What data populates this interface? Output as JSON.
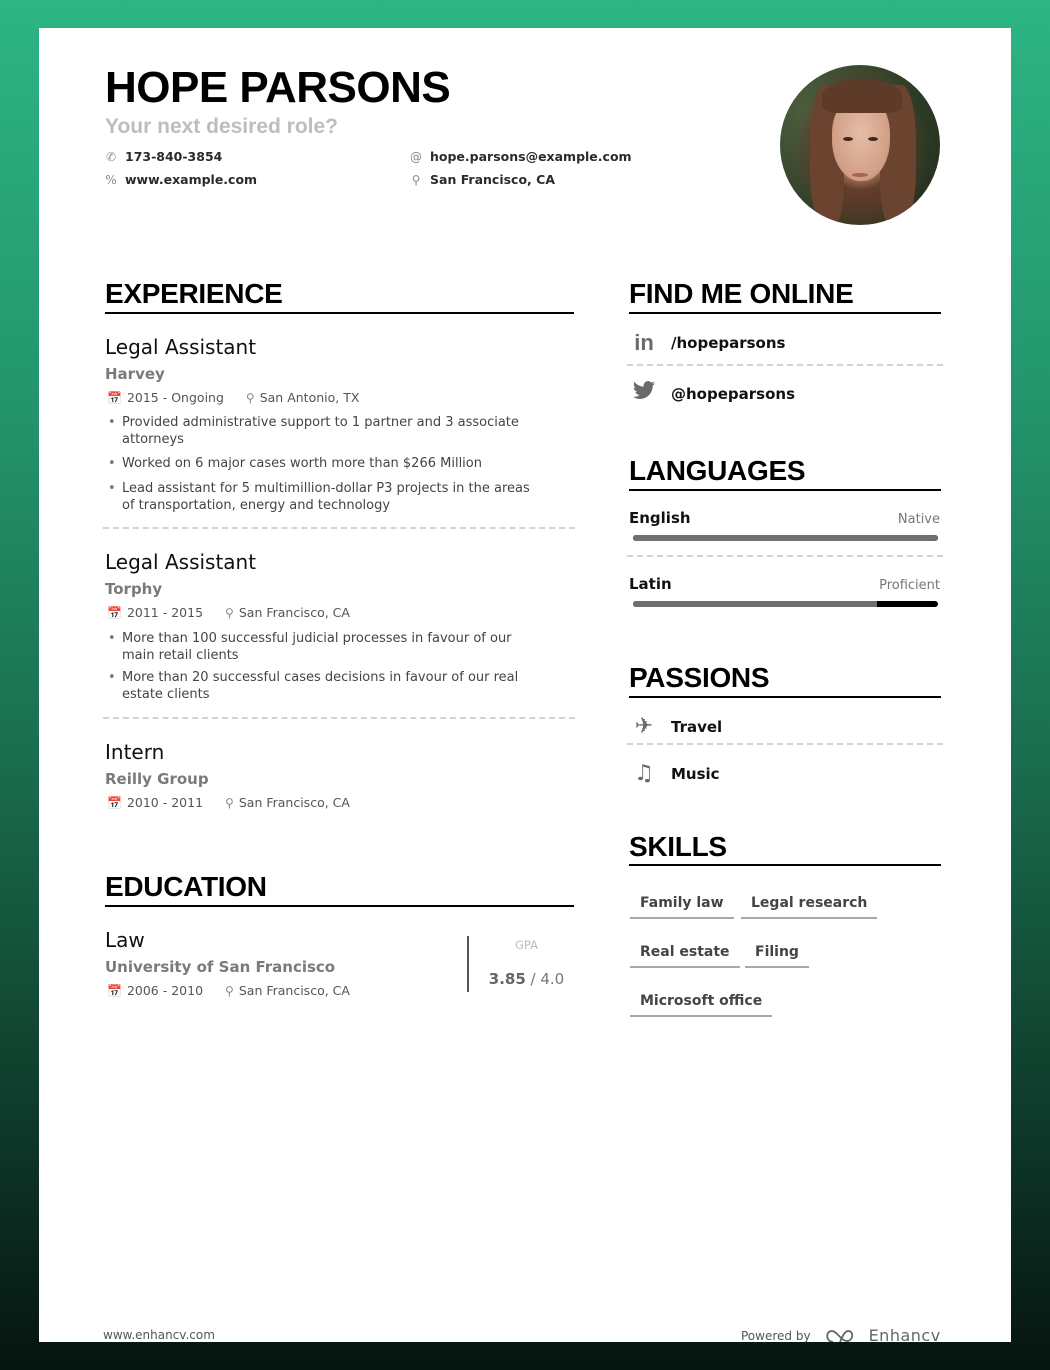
{
  "header": {
    "name": "HOPE PARSONS",
    "role": "Your next desired role?",
    "contacts": {
      "phone": "173-840-3854",
      "website": "www.example.com",
      "email": "hope.parsons@example.com",
      "location": "San Francisco, CA"
    },
    "icons": {
      "phone": "phone-icon",
      "website": "link-icon",
      "email": "at-icon",
      "location": "map-pin-icon"
    },
    "photo_alt": "Hope Parsons profile photo"
  },
  "experience": {
    "title": "EXPERIENCE",
    "items": [
      {
        "title": "Legal Assistant",
        "company": "Harvey",
        "dates": "2015 - Ongoing",
        "location": "San Antonio, TX",
        "bullets": [
          "Provided administrative support to 1 partner and 3 associate attorneys",
          "Worked on 6 major cases worth more than $266 Million",
          "Lead assistant for 5 multimillion-dollar P3 projects in the areas of transportation, energy and technology"
        ]
      },
      {
        "title": "Legal Assistant",
        "company": "Torphy",
        "dates": "2011 - 2015",
        "location": "San Francisco, CA",
        "bullets": [
          "More than 100 successful judicial processes in favour of our main retail clients",
          "More than 20 successful cases decisions in favour of our real estate clients"
        ]
      },
      {
        "title": "Intern",
        "company": "Reilly Group",
        "dates": "2010 - 2011",
        "location": "San Francisco, CA",
        "bullets": []
      }
    ]
  },
  "education": {
    "title": "EDUCATION",
    "items": [
      {
        "degree": "Law",
        "school": "University of San Francisco",
        "dates": "2006 - 2010",
        "location": "San Francisco, CA",
        "gpa_label": "GPA",
        "gpa": "3.85",
        "gpa_sep": " / ",
        "gpa_max": "4.0"
      }
    ]
  },
  "online": {
    "title": "FIND ME ONLINE",
    "items": [
      {
        "network": "LinkedIn",
        "icon": "linkedin-icon",
        "handle": "/hopeparsons"
      },
      {
        "network": "Twitter",
        "icon": "twitter-icon",
        "handle": "@hopeparsons"
      }
    ]
  },
  "languages": {
    "title": "LANGUAGES",
    "items": [
      {
        "name": "English",
        "level": "Native",
        "proficiency": 1.0
      },
      {
        "name": "Latin",
        "level": "Proficient",
        "proficiency": 0.8
      }
    ]
  },
  "passions": {
    "title": "PASSIONS",
    "items": [
      {
        "label": "Travel",
        "icon": "airplane-icon"
      },
      {
        "label": "Music",
        "icon": "music-note-icon"
      }
    ]
  },
  "skills": {
    "title": "SKILLS",
    "items": [
      "Family law",
      "Legal research",
      "Real estate",
      "Filing",
      "Microsoft office"
    ]
  },
  "footer": {
    "website": "www.enhancv.com",
    "powered_by": "Powered by",
    "brand": "Enhancv"
  },
  "colors": {
    "background_top": "#2db584",
    "background_bottom": "#06140f",
    "accent_text": "#7a7a7a",
    "bar_fill": "#6f6f6f",
    "bar_track": "#000000"
  }
}
